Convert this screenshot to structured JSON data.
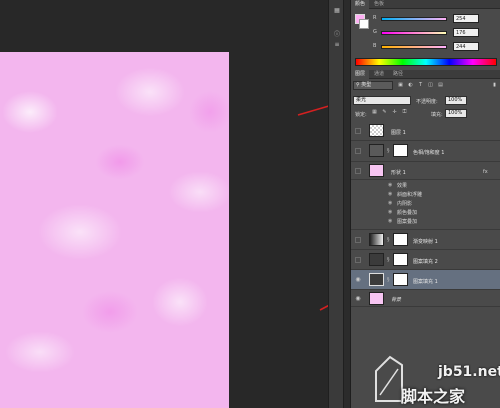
{
  "color_panel": {
    "tabs": [
      "颜色",
      "色板"
    ],
    "foreground_color": "#feb0f4",
    "background_color": "#ffffff",
    "sliders": [
      {
        "letter": "R",
        "value": "254"
      },
      {
        "letter": "G",
        "value": "176"
      },
      {
        "letter": "B",
        "value": "244"
      }
    ]
  },
  "layers_panel": {
    "tabs": [
      "图层",
      "通道",
      "路径"
    ],
    "filter_kind": "类型",
    "blend_mode": "柔光",
    "opacity_label": "不透明度:",
    "opacity_value": "100%",
    "lock_label": "锁定:",
    "fill_label": "填充:",
    "fill_value": "100%",
    "layers": [
      {
        "name": "图层 1"
      },
      {
        "name": "色相/饱和度 1"
      },
      {
        "name": "形状 1",
        "fx": "fx"
      },
      {
        "name": "渐变映射 1"
      },
      {
        "name": "图案填充 2"
      },
      {
        "name": "图案填充 1"
      },
      {
        "name": "背景"
      }
    ],
    "effects": [
      "效果",
      "斜面和浮雕",
      "内阴影",
      "颜色叠加",
      "图案叠加"
    ]
  },
  "watermark": {
    "site": "jb51.net",
    "name": "脚本之家"
  },
  "colors": {
    "canvas_pink": "#f3b6ee",
    "selection": "#657080",
    "arrow_red": "#d42020"
  }
}
